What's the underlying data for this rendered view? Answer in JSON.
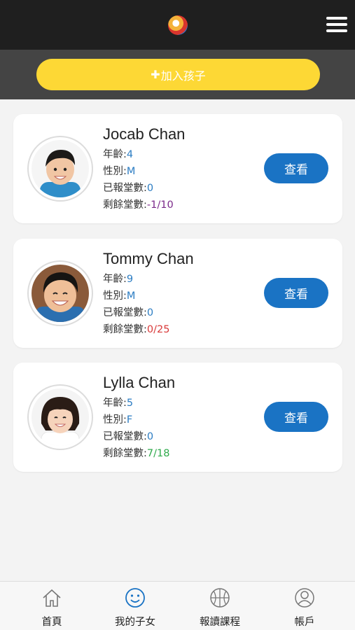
{
  "header": {
    "logo_icon": "circle-logo",
    "menu_icon": "hamburger-menu-icon"
  },
  "add_child": {
    "plus": "✚",
    "label": "加入孩子"
  },
  "labels": {
    "age": "年齡:",
    "gender": "性別:",
    "enrolled": "已報堂數:",
    "remaining": "剩餘堂數:",
    "view": "查看"
  },
  "children": [
    {
      "name": "Jocab Chan",
      "age": "4",
      "gender": "M",
      "enrolled": "0",
      "remaining": "-1/10",
      "remaining_color": "#7b2a8a"
    },
    {
      "name": "Tommy Chan",
      "age": "9",
      "gender": "M",
      "enrolled": "0",
      "remaining": "0/25",
      "remaining_color": "#d93a3a"
    },
    {
      "name": "Lylla Chan",
      "age": "5",
      "gender": "F",
      "enrolled": "0",
      "remaining": "7/18",
      "remaining_color": "#2eaa4b"
    }
  ],
  "tabs": [
    {
      "label": "首頁",
      "icon": "home-icon"
    },
    {
      "label": "我的子女",
      "icon": "smiley-icon",
      "active": true
    },
    {
      "label": "報讀課程",
      "icon": "basketball-icon"
    },
    {
      "label": "帳戶",
      "icon": "user-icon"
    }
  ],
  "colors": {
    "accent_yellow": "#fdd835",
    "button_blue": "#1a73c4",
    "value_blue": "#2c7dc3"
  }
}
